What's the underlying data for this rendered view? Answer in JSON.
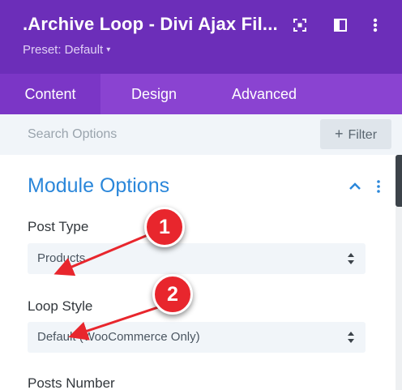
{
  "header": {
    "title": ".Archive Loop - Divi Ajax Fil...",
    "preset_label": "Preset: Default",
    "preset_caret": "▾",
    "icons": [
      "expand-icon",
      "sidebar-toggle-icon",
      "more-options-icon"
    ]
  },
  "tabs": [
    {
      "label": "Content",
      "active": true
    },
    {
      "label": "Design",
      "active": false
    },
    {
      "label": "Advanced",
      "active": false
    }
  ],
  "search": {
    "placeholder": "Search Options",
    "value": "",
    "filter_label": "Filter",
    "filter_icon": "plus-icon"
  },
  "section": {
    "title": "Module Options",
    "toggle_icon": "chevron-up-icon",
    "menu_icon": "vertical-dots-icon"
  },
  "fields": [
    {
      "label": "Post Type",
      "value": "Products"
    },
    {
      "label": "Loop Style",
      "value": "Default (WooCommerce Only)"
    },
    {
      "label": "Posts Number"
    }
  ],
  "annotations": [
    {
      "number": "1"
    },
    {
      "number": "2"
    }
  ],
  "colors": {
    "header_bg": "#6c2eb9",
    "tabs_bg": "#8a43d1",
    "active_tab_bg": "#7b36c6",
    "section_title": "#2b87da",
    "marker_red": "#e8262d",
    "field_bg": "#f1f5f9"
  }
}
